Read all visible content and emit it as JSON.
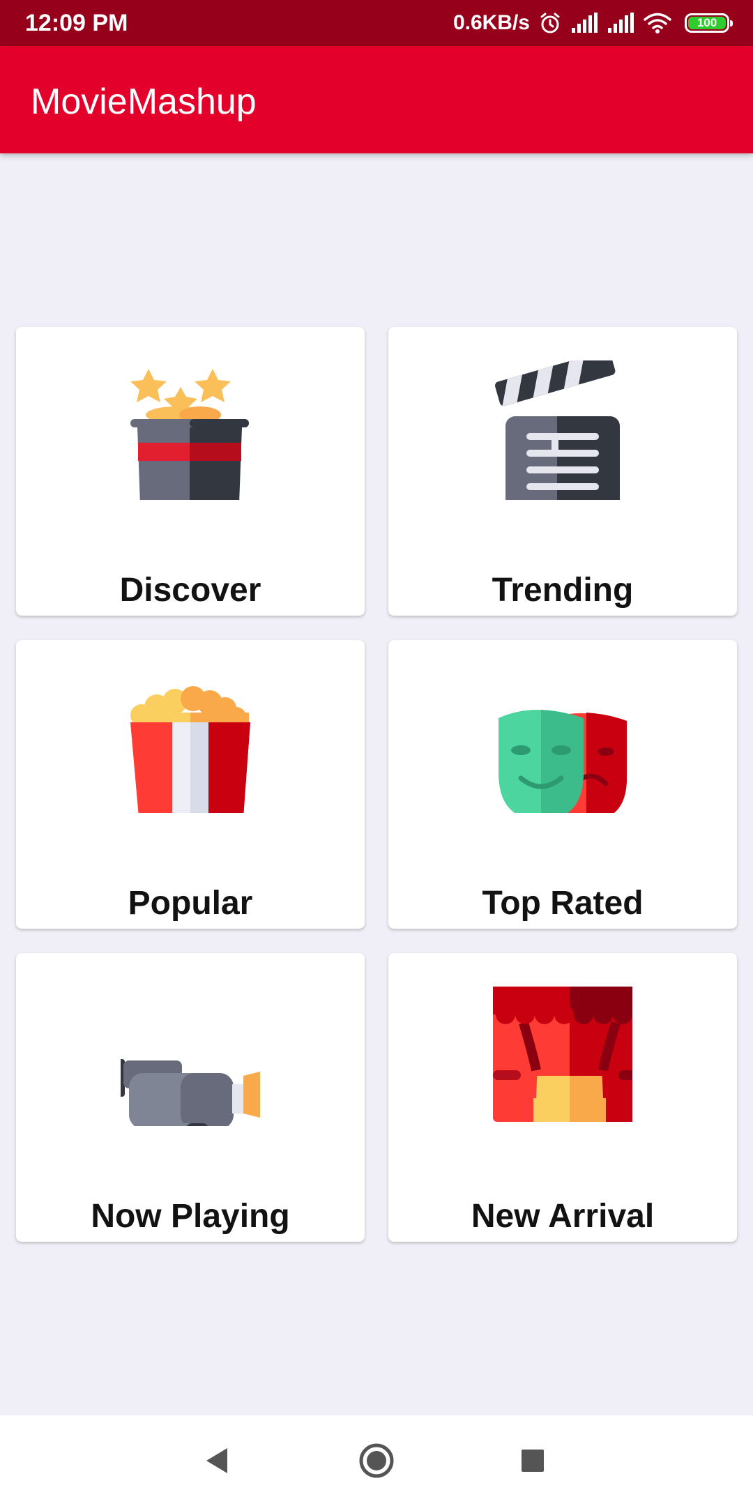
{
  "status_bar": {
    "time": "12:09 PM",
    "network_speed": "0.6KB/s",
    "battery_level": "100",
    "icons": [
      "alarm-icon",
      "signal-icon",
      "signal-icon",
      "wifi-icon",
      "battery-icon"
    ]
  },
  "app_bar": {
    "title": "MovieMashup"
  },
  "categories": [
    {
      "label": "Discover",
      "icon": "magic-hat-icon"
    },
    {
      "label": "Trending",
      "icon": "clapperboard-icon"
    },
    {
      "label": "Popular",
      "icon": "popcorn-icon"
    },
    {
      "label": "Top Rated",
      "icon": "theater-masks-icon"
    },
    {
      "label": "Now Playing",
      "icon": "video-camera-icon"
    },
    {
      "label": "New Arrival",
      "icon": "stage-curtains-icon"
    }
  ],
  "nav_bar": {
    "icons": [
      "back-icon",
      "home-icon",
      "recents-icon"
    ]
  },
  "colors": {
    "status_bar": "#97001b",
    "app_bar": "#e3002a",
    "background": "#f0eff7",
    "card": "#ffffff",
    "label_text": "#121212"
  }
}
